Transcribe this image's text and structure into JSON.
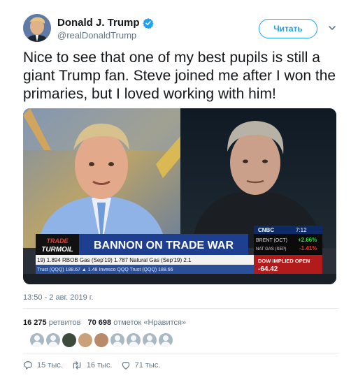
{
  "header": {
    "display_name": "Donald J. Trump",
    "handle": "@realDonaldTrump",
    "follow_label": "Читать"
  },
  "tweet": {
    "text": "Nice to see that one of my best pupils is still a giant Trump fan. Steve joined me after I won the primaries, but I loved working with him!"
  },
  "media": {
    "brand_top": "TRADE",
    "brand_bottom": "TURMOIL",
    "headline": "BANNON ON TRADE WAR",
    "network": "CNBC",
    "clock": "7:12",
    "ticker_right": [
      {
        "label": "BRENT (OCT)",
        "value": "+2.66%"
      },
      {
        "label": "NAT GAS (SEP)",
        "value": "-1.41%"
      }
    ],
    "dow_label": "DOW IMPLIED OPEN",
    "dow_value": "-64.42",
    "ticker_line1": "19) 1.894   RBOB Gas (Sep'19) 1.787   Natural Gas (Sep'19) 2.1",
    "ticker_line2": "Trust (QQQ) 188.67 ▲ 1.48   Invesco QQQ Trust (QQQ) 188.66"
  },
  "footer": {
    "timestamp": "13:50 - 2 авг. 2019 г.",
    "retweets_count": "16 275",
    "retweets_label": "ретвитов",
    "likes_count": "70 698",
    "likes_label": "отметок «Нравится»",
    "reply_count": "15 тыс.",
    "retweet_count_short": "16 тыс.",
    "like_count_short": "71 тыс."
  },
  "colors": {
    "accent": "#1da1f2",
    "text": "#14171a",
    "muted": "#657786",
    "cnbc_blue": "#1e3f8f"
  },
  "icons": [
    "verified-icon",
    "chevron-down-icon",
    "reply-icon",
    "retweet-icon",
    "like-icon"
  ]
}
